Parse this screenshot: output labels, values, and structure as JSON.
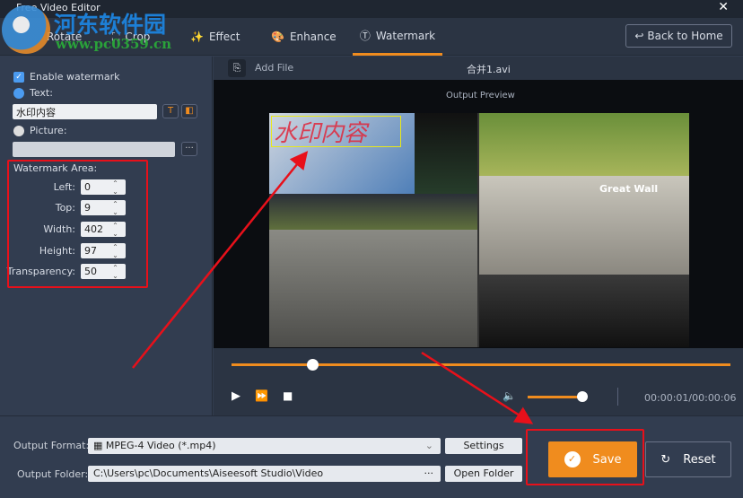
{
  "app": {
    "title": "Free Video Editor",
    "close": "✕"
  },
  "watermark_logo": {
    "name": "河东软件园",
    "url": "www.pc0359.cn"
  },
  "tabs": [
    {
      "label": "Rotate"
    },
    {
      "label": "Crop"
    },
    {
      "label": "Effect"
    },
    {
      "label": "Enhance"
    },
    {
      "label": "Watermark",
      "active": true
    }
  ],
  "back_label": "Back to Home",
  "left": {
    "enable": "Enable watermark",
    "text_label": "Text:",
    "text_value": "水印内容",
    "picture_label": "Picture:",
    "picture_value": "",
    "browse": "···",
    "area_title": "Watermark Area:",
    "fields": [
      {
        "label": "Left:",
        "value": "0"
      },
      {
        "label": "Top:",
        "value": "9"
      },
      {
        "label": "Width:",
        "value": "402"
      },
      {
        "label": "Height:",
        "value": "97"
      },
      {
        "label": "Transparency:",
        "value": "50"
      }
    ]
  },
  "file": {
    "add_label": "Add File",
    "filename": "合并1.avi"
  },
  "preview": {
    "title": "Output Preview",
    "overlay_text": "水印内容",
    "scene_text": "Great Wall"
  },
  "player": {
    "progress": 0.165,
    "volume": 0.88,
    "time": "00:00:01/00:00:06"
  },
  "output": {
    "format_label": "Output Format:",
    "format_value": "MPEG-4 Video (*.mp4)",
    "settings": "Settings",
    "folder_label": "Output Folder:",
    "folder_value": "C:\\Users\\pc\\Documents\\Aiseesoft Studio\\Video",
    "folder_dots": "···",
    "open_folder": "Open Folder"
  },
  "actions": {
    "save": "Save",
    "reset": "Reset"
  },
  "colors": {
    "accent": "#f08c1e",
    "annotation": "#e8101a"
  }
}
